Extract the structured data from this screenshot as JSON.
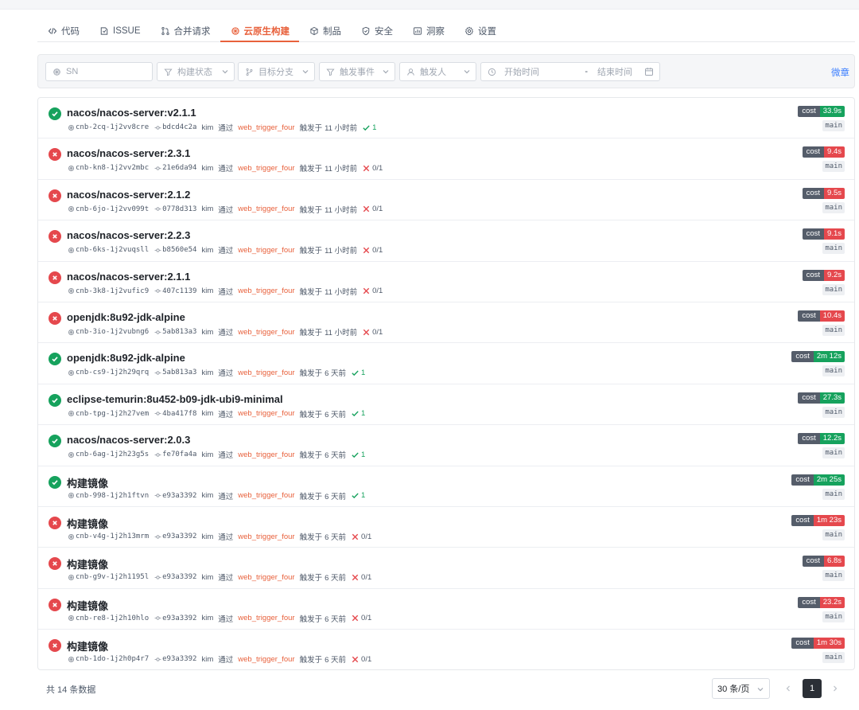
{
  "tabs": [
    {
      "label": "代码",
      "icon": "code-icon",
      "active": false
    },
    {
      "label": "ISSUE",
      "icon": "issue-icon",
      "active": false
    },
    {
      "label": "合并请求",
      "icon": "pull-request-icon",
      "active": false
    },
    {
      "label": "云原生构建",
      "icon": "build-icon",
      "active": true
    },
    {
      "label": "制品",
      "icon": "package-icon",
      "active": false
    },
    {
      "label": "安全",
      "icon": "shield-icon",
      "active": false
    },
    {
      "label": "洞察",
      "icon": "insight-icon",
      "active": false
    },
    {
      "label": "设置",
      "icon": "gear-icon",
      "active": false
    }
  ],
  "filters": {
    "sn_placeholder": "SN",
    "status_placeholder": "构建状态",
    "branch_placeholder": "目标分支",
    "event_placeholder": "触发事件",
    "user_placeholder": "触发人",
    "start_placeholder": "开始时间",
    "date_separator": "-",
    "end_placeholder": "结束时间",
    "save_label": "微章"
  },
  "labels": {
    "via": "通过",
    "triggered_at": "触发于",
    "cost": "cost"
  },
  "builds": [
    {
      "title": "nacos/nacos-server:v2.1.1",
      "status": "ok",
      "sn": "cnb-2cq-1j2vv8cre",
      "commit": "bdcd4c2a",
      "user": "kim",
      "trigger": "web_trigger_four",
      "time": "11 小时前",
      "result": "1",
      "cost": "33.9s",
      "branch": "main"
    },
    {
      "title": "nacos/nacos-server:2.3.1",
      "status": "fail",
      "sn": "cnb-kn8-1j2vv2mbc",
      "commit": "21e6da94",
      "user": "kim",
      "trigger": "web_trigger_four",
      "time": "11 小时前",
      "result": "0/1",
      "cost": "9.4s",
      "branch": "main"
    },
    {
      "title": "nacos/nacos-server:2.1.2",
      "status": "fail",
      "sn": "cnb-6jo-1j2vv099t",
      "commit": "0778d313",
      "user": "kim",
      "trigger": "web_trigger_four",
      "time": "11 小时前",
      "result": "0/1",
      "cost": "9.5s",
      "branch": "main"
    },
    {
      "title": "nacos/nacos-server:2.2.3",
      "status": "fail",
      "sn": "cnb-6ks-1j2vuqsll",
      "commit": "b8560e54",
      "user": "kim",
      "trigger": "web_trigger_four",
      "time": "11 小时前",
      "result": "0/1",
      "cost": "9.1s",
      "branch": "main"
    },
    {
      "title": "nacos/nacos-server:2.1.1",
      "status": "fail",
      "sn": "cnb-3k8-1j2vufic9",
      "commit": "407c1139",
      "user": "kim",
      "trigger": "web_trigger_four",
      "time": "11 小时前",
      "result": "0/1",
      "cost": "9.2s",
      "branch": "main"
    },
    {
      "title": "openjdk:8u92-jdk-alpine",
      "status": "fail",
      "sn": "cnb-3io-1j2vubng6",
      "commit": "5ab813a3",
      "user": "kim",
      "trigger": "web_trigger_four",
      "time": "11 小时前",
      "result": "0/1",
      "cost": "10.4s",
      "branch": "main"
    },
    {
      "title": "openjdk:8u92-jdk-alpine",
      "status": "ok",
      "sn": "cnb-cs9-1j2h29qrq",
      "commit": "5ab813a3",
      "user": "kim",
      "trigger": "web_trigger_four",
      "time": "6 天前",
      "result": "1",
      "cost": "2m 12s",
      "branch": "main"
    },
    {
      "title": "eclipse-temurin:8u452-b09-jdk-ubi9-minimal",
      "status": "ok",
      "sn": "cnb-tpg-1j2h27vem",
      "commit": "4ba417f8",
      "user": "kim",
      "trigger": "web_trigger_four",
      "time": "6 天前",
      "result": "1",
      "cost": "27.3s",
      "branch": "main"
    },
    {
      "title": "nacos/nacos-server:2.0.3",
      "status": "ok",
      "sn": "cnb-6ag-1j2h23g5s",
      "commit": "fe70fa4a",
      "user": "kim",
      "trigger": "web_trigger_four",
      "time": "6 天前",
      "result": "1",
      "cost": "12.2s",
      "branch": "main"
    },
    {
      "title": "构建镜像",
      "status": "ok",
      "sn": "cnb-998-1j2h1ftvn",
      "commit": "e93a3392",
      "user": "kim",
      "trigger": "web_trigger_four",
      "time": "6 天前",
      "result": "1",
      "cost": "2m 25s",
      "branch": "main"
    },
    {
      "title": "构建镜像",
      "status": "fail",
      "sn": "cnb-v4g-1j2h13mrm",
      "commit": "e93a3392",
      "user": "kim",
      "trigger": "web_trigger_four",
      "time": "6 天前",
      "result": "0/1",
      "cost": "1m 23s",
      "branch": "main"
    },
    {
      "title": "构建镜像",
      "status": "fail",
      "sn": "cnb-g9v-1j2h1195l",
      "commit": "e93a3392",
      "user": "kim",
      "trigger": "web_trigger_four",
      "time": "6 天前",
      "result": "0/1",
      "cost": "6.8s",
      "branch": "main"
    },
    {
      "title": "构建镜像",
      "status": "fail",
      "sn": "cnb-re8-1j2h10hlo",
      "commit": "e93a3392",
      "user": "kim",
      "trigger": "web_trigger_four",
      "time": "6 天前",
      "result": "0/1",
      "cost": "23.2s",
      "branch": "main"
    },
    {
      "title": "构建镜像",
      "status": "fail",
      "sn": "cnb-1do-1j2h0p4r7",
      "commit": "e93a3392",
      "user": "kim",
      "trigger": "web_trigger_four",
      "time": "6 天前",
      "result": "0/1",
      "cost": "1m 30s",
      "branch": "main"
    }
  ],
  "footer": {
    "total_text": "共 14 条数据",
    "page_size": "30 条/页",
    "current_page": "1"
  },
  "colors": {
    "accent": "#e8613c",
    "success": "#16a25d",
    "failure": "#e5484d",
    "link": "#3d7fff"
  }
}
